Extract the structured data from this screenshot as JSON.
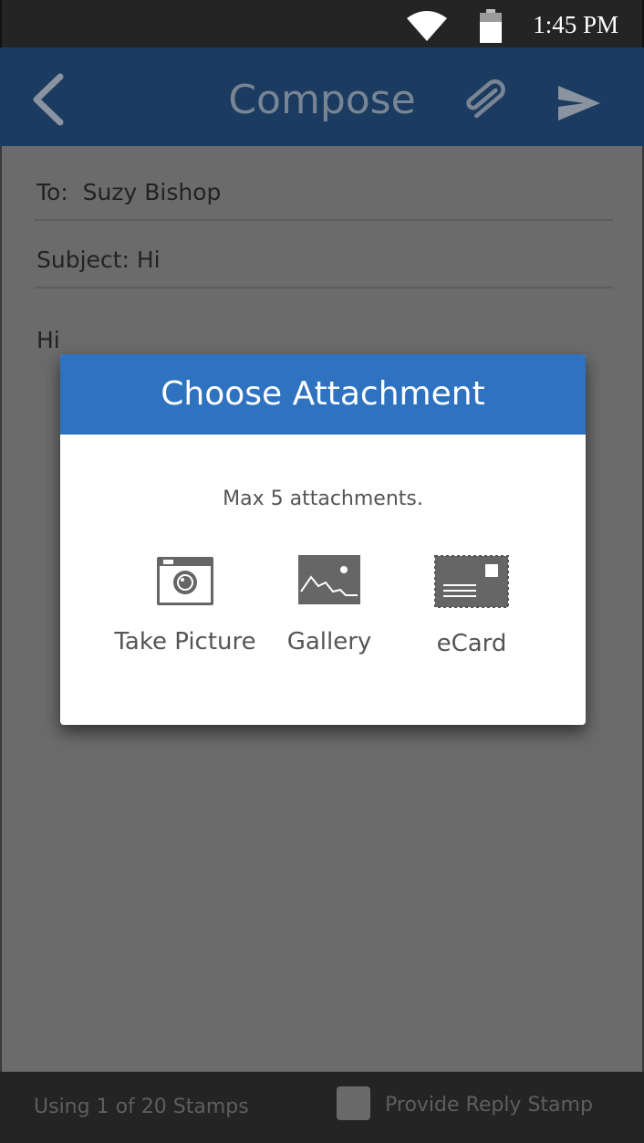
{
  "status_bar": {
    "time": "1:45 PM",
    "wifi_icon": "wifi-icon",
    "battery_icon": "battery-icon"
  },
  "header": {
    "title": "Compose",
    "back_icon": "chevron-left-icon",
    "attach_icon": "paperclip-icon",
    "send_icon": "send-icon",
    "background": "#1b3c60"
  },
  "compose": {
    "to_label": "To:",
    "to_value": "Suzy Bishop",
    "subject_label": "Subject:",
    "subject_value": "Hi",
    "body": "Hi"
  },
  "dialog": {
    "title": "Choose Attachment",
    "note": "Max 5 attachments.",
    "accent": "#2f73c0",
    "options": [
      {
        "label": "Take Picture",
        "icon": "camera-icon"
      },
      {
        "label": "Gallery",
        "icon": "image-icon"
      },
      {
        "label": "eCard",
        "icon": "ecard-icon"
      }
    ]
  },
  "footer": {
    "stamps_text": "Using 1 of 20 Stamps",
    "reply_stamp_label": "Provide Reply Stamp",
    "reply_stamp_checked": false
  }
}
